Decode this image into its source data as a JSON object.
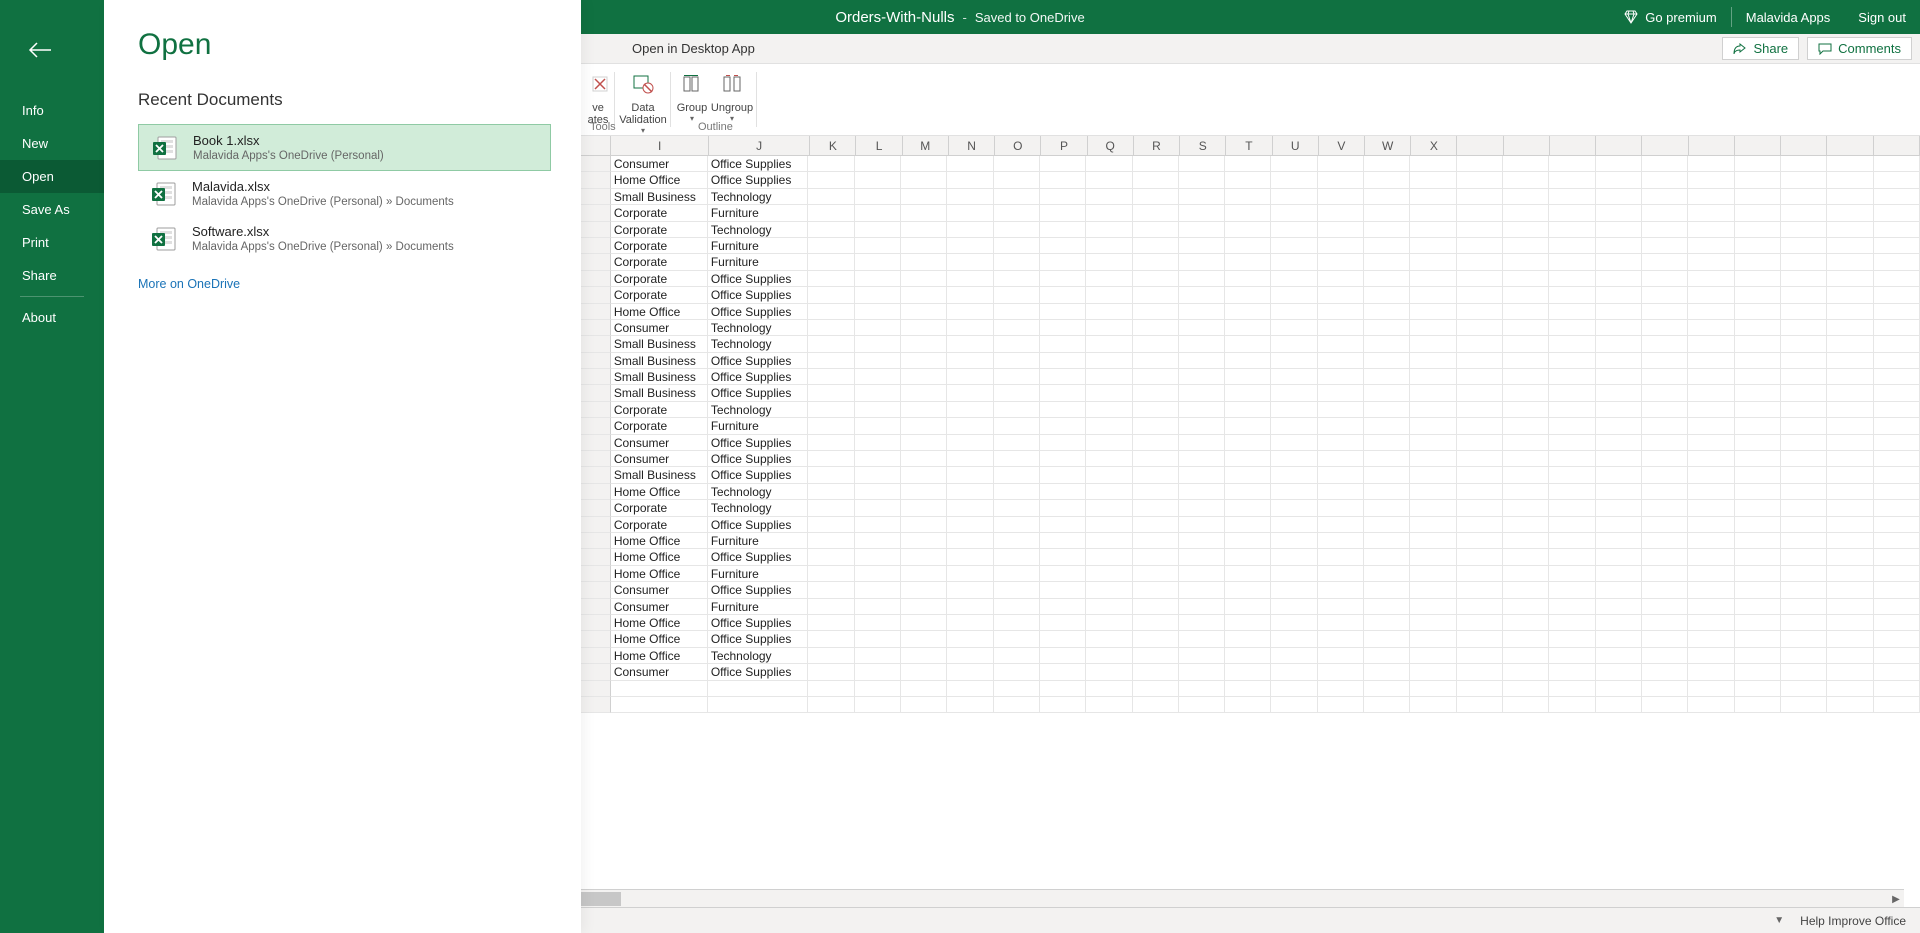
{
  "titlebar": {
    "doc_name": "Orders-With-Nulls",
    "dash": "-",
    "saved_text": "Saved to OneDrive",
    "go_premium": "Go premium",
    "user": "Malavida Apps",
    "signout": "Sign out"
  },
  "secbar": {
    "open_desktop": "Open in Desktop App",
    "share": "Share",
    "comments": "Comments"
  },
  "ribbon": {
    "partial_btn_1_suffix": "ve",
    "partial_btn_2_suffix": "ates",
    "data_validation": "Data",
    "data_validation2": "Validation",
    "group": "Group",
    "ungroup": "Ungroup",
    "section_tools_suffix": "Tools",
    "section_outline": "Outline"
  },
  "statusbar": {
    "help": "Help Improve Office"
  },
  "backstage": {
    "title": "Open",
    "nav": [
      "Info",
      "New",
      "Open",
      "Save As",
      "Print",
      "Share",
      "About"
    ],
    "active_index": 2,
    "section": "Recent Documents",
    "docs": [
      {
        "name": "Book 1.xlsx",
        "path": "Malavida Apps's OneDrive (Personal)"
      },
      {
        "name": "Malavida.xlsx",
        "path": "Malavida Apps's OneDrive (Personal) » Documents"
      },
      {
        "name": "Software.xlsx",
        "path": "Malavida Apps's OneDrive (Personal) » Documents"
      }
    ],
    "more": "More on OneDrive"
  },
  "sheet": {
    "columns": [
      "I",
      "J",
      "K",
      "L",
      "M",
      "N",
      "O",
      "P",
      "Q",
      "R",
      "S",
      "T",
      "U",
      "V",
      "W",
      "X"
    ],
    "rows": [
      {
        "I": "Consumer",
        "J": "Office Supplies"
      },
      {
        "I": "Home Office",
        "J": "Office Supplies"
      },
      {
        "I": "Small Business",
        "J": "Technology"
      },
      {
        "I": "Corporate",
        "J": "Furniture"
      },
      {
        "I": "Corporate",
        "J": "Technology"
      },
      {
        "I": "Corporate",
        "J": "Furniture"
      },
      {
        "I": "Corporate",
        "J": "Furniture"
      },
      {
        "I": "Corporate",
        "J": "Office Supplies"
      },
      {
        "I": "Corporate",
        "J": "Office Supplies"
      },
      {
        "I": "Home Office",
        "J": "Office Supplies"
      },
      {
        "I": "Consumer",
        "J": "Technology"
      },
      {
        "I": "Small Business",
        "J": "Technology"
      },
      {
        "I": "Small Business",
        "J": "Office Supplies"
      },
      {
        "I": "Small Business",
        "J": "Office Supplies"
      },
      {
        "I": "Small Business",
        "J": "Office Supplies"
      },
      {
        "I": "Corporate",
        "J": "Technology"
      },
      {
        "I": "Corporate",
        "J": "Furniture"
      },
      {
        "I": "Consumer",
        "J": "Office Supplies"
      },
      {
        "I": "Consumer",
        "J": "Office Supplies"
      },
      {
        "I": "Small Business",
        "J": "Office Supplies"
      },
      {
        "I": "Home Office",
        "J": "Technology"
      },
      {
        "I": "Corporate",
        "J": "Technology"
      },
      {
        "I": "Corporate",
        "J": "Office Supplies"
      },
      {
        "I": "Home Office",
        "J": "Furniture"
      },
      {
        "I": "Home Office",
        "J": "Office Supplies"
      },
      {
        "I": "Home Office",
        "J": "Furniture"
      },
      {
        "I": "Consumer",
        "J": "Office Supplies"
      },
      {
        "I": "Consumer",
        "J": "Furniture"
      },
      {
        "I": "Home Office",
        "J": "Office Supplies"
      },
      {
        "I": "Home Office",
        "J": "Office Supplies"
      },
      {
        "I": "Home Office",
        "J": "Technology"
      },
      {
        "I": "Consumer",
        "J": "Office Supplies"
      }
    ]
  }
}
